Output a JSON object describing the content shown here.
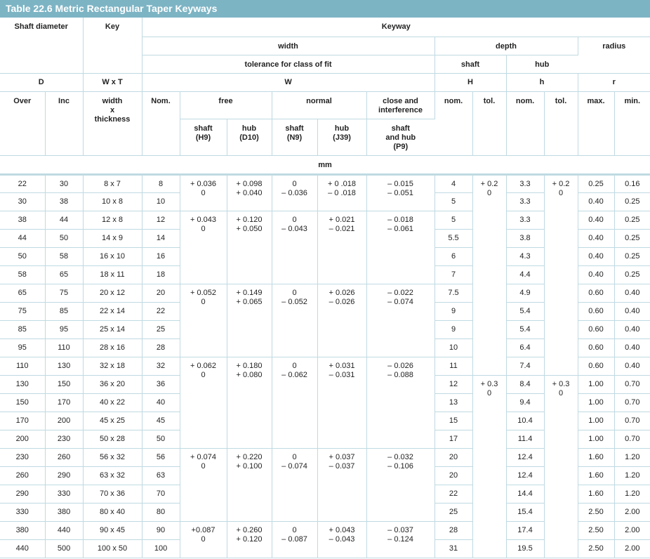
{
  "title": "Table 22.6 Metric Rectangular Taper Keyways",
  "headers": {
    "shaft_diameter": "Shaft diameter",
    "key": "Key",
    "keyway": "Keyway",
    "width": "width",
    "depth": "depth",
    "radius": "radius",
    "tolerance": "tolerance for class of fit",
    "shaft": "shaft",
    "hub": "hub",
    "D": "D",
    "WxT": "W x T",
    "W": "W",
    "H": "H",
    "h": "h",
    "r": "r",
    "over": "Over",
    "inc": "Inc",
    "key_wt_1": "width",
    "key_wt_2": "x",
    "key_wt_3": "thickness",
    "nom": "Nom.",
    "free": "free",
    "normal": "normal",
    "close_1": "close and",
    "close_2": "interference",
    "nom_l": "nom.",
    "tol": "tol.",
    "max": "max.",
    "min": "min.",
    "h9_1": "shaft",
    "h9_2": "(H9)",
    "d10_1": "hub",
    "d10_2": "(D10)",
    "n9_1": "shaft",
    "n9_2": "(N9)",
    "j39_1": "hub",
    "j39_2": "(J39)",
    "p9_1": "shaft",
    "p9_2": "and hub",
    "p9_3": "(P9)",
    "unit": "mm"
  },
  "rows": [
    {
      "over": "22",
      "inc": "30",
      "key": "8 x 7",
      "nom": "8",
      "H": "4",
      "h": "3.3",
      "rmax": "0.25",
      "rmin": "0.16"
    },
    {
      "over": "30",
      "inc": "38",
      "key": "10 x 8",
      "nom": "10",
      "H": "5",
      "h": "3.3",
      "rmax": "0.40",
      "rmin": "0.25"
    },
    {
      "over": "38",
      "inc": "44",
      "key": "12 x 8",
      "nom": "12",
      "H": "5",
      "h": "3.3",
      "rmax": "0.40",
      "rmin": "0.25"
    },
    {
      "over": "44",
      "inc": "50",
      "key": "14 x 9",
      "nom": "14",
      "H": "5.5",
      "h": "3.8",
      "rmax": "0.40",
      "rmin": "0.25"
    },
    {
      "over": "50",
      "inc": "58",
      "key": "16 x 10",
      "nom": "16",
      "H": "6",
      "h": "4.3",
      "rmax": "0.40",
      "rmin": "0.25"
    },
    {
      "over": "58",
      "inc": "65",
      "key": "18 x 11",
      "nom": "18",
      "H": "7",
      "h": "4.4",
      "rmax": "0.40",
      "rmin": "0.25"
    },
    {
      "over": "65",
      "inc": "75",
      "key": "20 x 12",
      "nom": "20",
      "H": "7.5",
      "h": "4.9",
      "rmax": "0.60",
      "rmin": "0.40"
    },
    {
      "over": "75",
      "inc": "85",
      "key": "22 x 14",
      "nom": "22",
      "H": "9",
      "h": "5.4",
      "rmax": "0.60",
      "rmin": "0.40"
    },
    {
      "over": "85",
      "inc": "95",
      "key": "25 x 14",
      "nom": "25",
      "H": "9",
      "h": "5.4",
      "rmax": "0.60",
      "rmin": "0.40"
    },
    {
      "over": "95",
      "inc": "110",
      "key": "28 x 16",
      "nom": "28",
      "H": "10",
      "h": "6.4",
      "rmax": "0.60",
      "rmin": "0.40"
    },
    {
      "over": "110",
      "inc": "130",
      "key": "32 x 18",
      "nom": "32",
      "H": "11",
      "h": "7.4",
      "rmax": "0.60",
      "rmin": "0.40"
    },
    {
      "over": "130",
      "inc": "150",
      "key": "36 x 20",
      "nom": "36",
      "H": "12",
      "h": "8.4",
      "rmax": "1.00",
      "rmin": "0.70"
    },
    {
      "over": "150",
      "inc": "170",
      "key": "40 x 22",
      "nom": "40",
      "H": "13",
      "h": "9.4",
      "rmax": "1.00",
      "rmin": "0.70"
    },
    {
      "over": "170",
      "inc": "200",
      "key": "45 x 25",
      "nom": "45",
      "H": "15",
      "h": "10.4",
      "rmax": "1.00",
      "rmin": "0.70"
    },
    {
      "over": "200",
      "inc": "230",
      "key": "50 x 28",
      "nom": "50",
      "H": "17",
      "h": "11.4",
      "rmax": "1.00",
      "rmin": "0.70"
    },
    {
      "over": "230",
      "inc": "260",
      "key": "56 x 32",
      "nom": "56",
      "H": "20",
      "h": "12.4",
      "rmax": "1.60",
      "rmin": "1.20"
    },
    {
      "over": "260",
      "inc": "290",
      "key": "63 x 32",
      "nom": "63",
      "H": "20",
      "h": "12.4",
      "rmax": "1.60",
      "rmin": "1.20"
    },
    {
      "over": "290",
      "inc": "330",
      "key": "70 x 36",
      "nom": "70",
      "H": "22",
      "h": "14.4",
      "rmax": "1.60",
      "rmin": "1.20"
    },
    {
      "over": "330",
      "inc": "380",
      "key": "80 x 40",
      "nom": "80",
      "H": "25",
      "h": "15.4",
      "rmax": "2.50",
      "rmin": "2.00"
    },
    {
      "over": "380",
      "inc": "440",
      "key": "90 x 45",
      "nom": "90",
      "H": "28",
      "h": "17.4",
      "rmax": "2.50",
      "rmin": "2.00"
    },
    {
      "over": "440",
      "inc": "500",
      "key": "100 x 50",
      "nom": "100",
      "H": "31",
      "h": "19.5",
      "rmax": "2.50",
      "rmin": "2.00"
    }
  ],
  "tolerance_groups": [
    {
      "start": 0,
      "span": 2,
      "h9": [
        "+ 0.036",
        "0"
      ],
      "d10": [
        "+ 0.098",
        "+ 0.040"
      ],
      "n9": [
        "0",
        "– 0.036"
      ],
      "j39": [
        "+ 0 .018",
        "– 0 .018"
      ],
      "p9": [
        "– 0.015",
        "– 0.051"
      ]
    },
    {
      "start": 2,
      "span": 4,
      "h9": [
        "+ 0.043",
        "0"
      ],
      "d10": [
        "+ 0.120",
        "+ 0.050"
      ],
      "n9": [
        "0",
        "– 0.043"
      ],
      "j39": [
        "+ 0.021",
        "– 0.021"
      ],
      "p9": [
        "– 0.018",
        "– 0.061"
      ]
    },
    {
      "start": 6,
      "span": 4,
      "h9": [
        "+ 0.052",
        "0"
      ],
      "d10": [
        "+ 0.149",
        "+ 0.065"
      ],
      "n9": [
        "0",
        "– 0.052"
      ],
      "j39": [
        "+ 0.026",
        "– 0.026"
      ],
      "p9": [
        "– 0.022",
        "– 0.074"
      ]
    },
    {
      "start": 10,
      "span": 5,
      "h9": [
        "+ 0.062",
        "0"
      ],
      "d10": [
        "+ 0.180",
        "+ 0.080"
      ],
      "n9": [
        "0",
        "– 0.062"
      ],
      "j39": [
        "+ 0.031",
        "– 0.031"
      ],
      "p9": [
        "– 0.026",
        "– 0.088"
      ]
    },
    {
      "start": 15,
      "span": 4,
      "h9": [
        "+ 0.074",
        "0"
      ],
      "d10": [
        "+ 0.220",
        "+ 0.100"
      ],
      "n9": [
        "0",
        "– 0.074"
      ],
      "j39": [
        "+ 0.037",
        "– 0.037"
      ],
      "p9": [
        "– 0.032",
        "– 0.106"
      ]
    },
    {
      "start": 19,
      "span": 2,
      "h9": [
        "+0.087",
        "0"
      ],
      "d10": [
        "+ 0.260",
        "+ 0.120"
      ],
      "n9": [
        "0",
        "– 0.087"
      ],
      "j39": [
        "+ 0.043",
        "– 0.043"
      ],
      "p9": [
        "– 0.037",
        "– 0.124"
      ]
    }
  ],
  "depth_tol_groups": [
    {
      "start": 0,
      "span": 11,
      "shaft": [
        "+ 0.2",
        "0"
      ],
      "hub": [
        "+ 0.2",
        "0"
      ]
    },
    {
      "start": 11,
      "span": 10,
      "shaft": [
        "+ 0.3",
        "0"
      ],
      "hub": [
        "+ 0.3",
        "0"
      ]
    }
  ]
}
